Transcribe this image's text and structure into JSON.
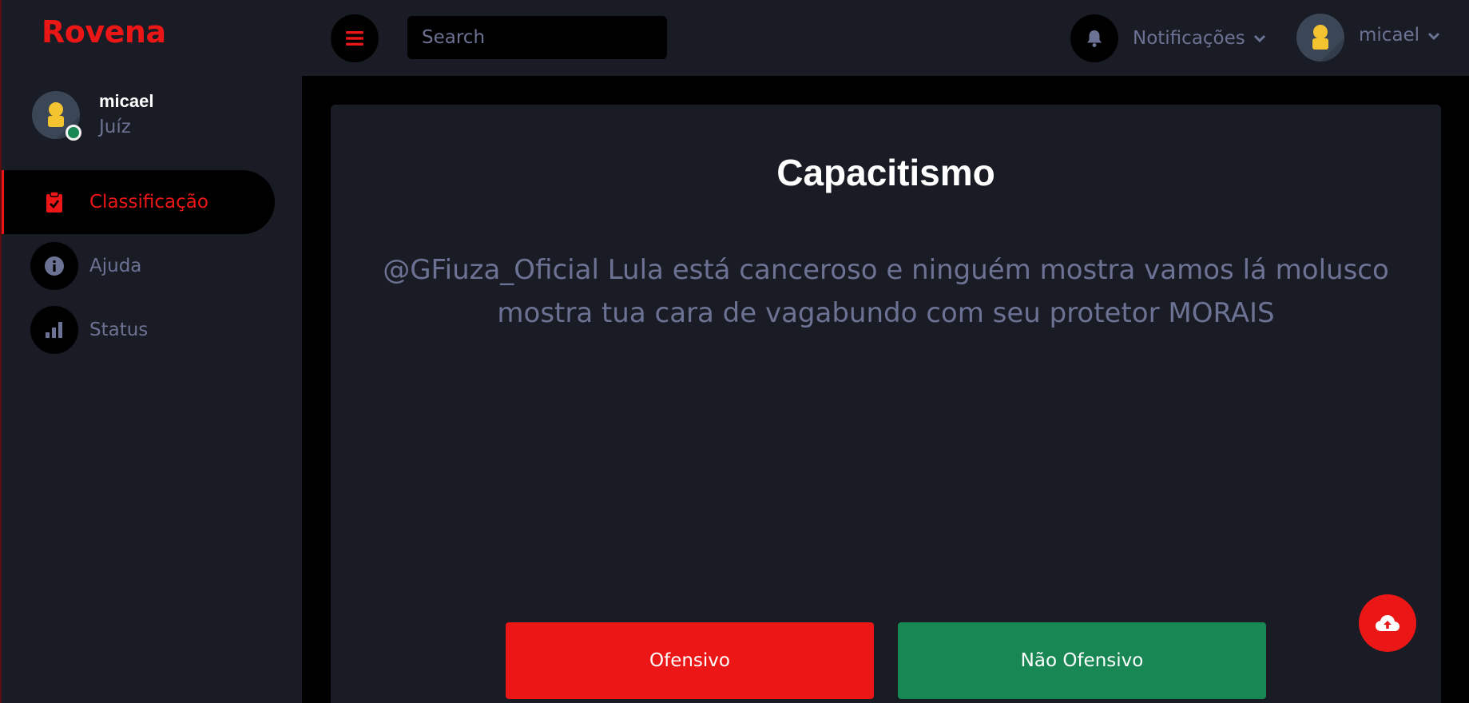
{
  "brand": {
    "name": "Rovena"
  },
  "profile": {
    "name": "micael",
    "role": "Juíz"
  },
  "nav": [
    {
      "label": "Classificação",
      "icon": "clipboard-check-icon",
      "active": true
    },
    {
      "label": "Ajuda",
      "icon": "info-icon",
      "active": false
    },
    {
      "label": "Status",
      "icon": "bar-chart-icon",
      "active": false
    }
  ],
  "topbar": {
    "search_placeholder": "Search",
    "notifications_label": "Notificações",
    "user_name": "micael"
  },
  "card": {
    "title": "Capacitismo",
    "text": "@GFiuza_Oficial Lula está canceroso e ninguém mostra vamos lá molusco mostra tua cara de vagabundo com seu protetor MORAIS",
    "offensive_label": "Ofensivo",
    "non_offensive_label": "Não Ofensivo"
  },
  "colors": {
    "accent": "#eb1616",
    "success": "#198754",
    "panel": "#191c24",
    "muted_text": "#6c7293",
    "background": "#000000"
  }
}
